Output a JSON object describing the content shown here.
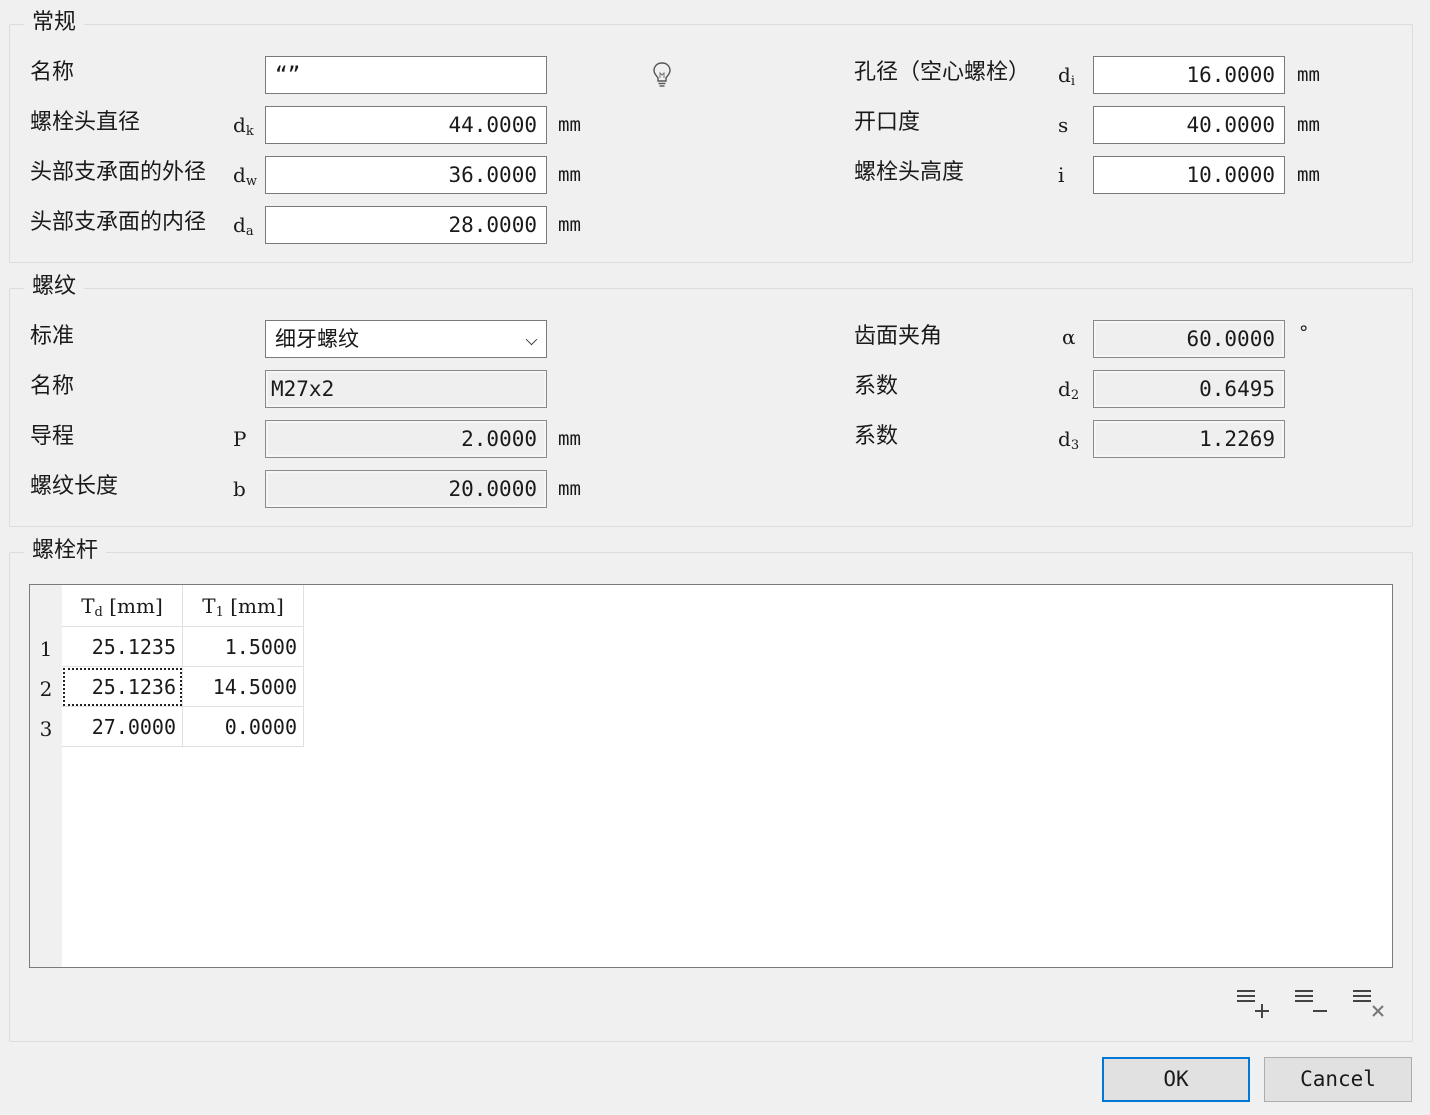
{
  "general": {
    "title": "常规",
    "name_label": "名称",
    "name_value": "“”",
    "head_dia_label": "螺栓头直径",
    "head_dia_sym": "d",
    "head_dia_sub": "k",
    "head_dia_value": "44.0000",
    "bear_outer_label": "头部支承面的外径",
    "bear_outer_sym": "d",
    "bear_outer_sub": "w",
    "bear_outer_value": "36.0000",
    "bear_inner_label": "头部支承面的内径",
    "bear_inner_sym": "d",
    "bear_inner_sub": "a",
    "bear_inner_value": "28.0000",
    "bore_label": "孔径（空心螺栓）",
    "bore_sym": "d",
    "bore_sub": "i",
    "bore_value": "16.0000",
    "wrench_label": "开口度",
    "wrench_sym": "s",
    "wrench_value": "40.0000",
    "head_height_label": "螺栓头高度",
    "head_height_sym": "i",
    "head_height_value": "10.0000",
    "unit": "mm"
  },
  "thread": {
    "title": "螺纹",
    "standard_label": "标准",
    "standard_value": "细牙螺纹",
    "name_label": "名称",
    "name_value": "M27x2",
    "pitch_label": "导程",
    "pitch_sym": "P",
    "pitch_value": "2.0000",
    "length_label": "螺纹长度",
    "length_sym": "b",
    "length_value": "20.0000",
    "flank_label": "齿面夹角",
    "flank_sym": "α",
    "flank_value": "60.0000",
    "flank_unit": "°",
    "coef1_label": "系数",
    "coef1_sym": "d",
    "coef1_sub": "2",
    "coef1_value": "0.6495",
    "coef2_label": "系数",
    "coef2_sym": "d",
    "coef2_sub": "3",
    "coef2_value": "1.2269",
    "unit": "mm"
  },
  "shank": {
    "title": "螺栓杆",
    "col1_sym": "T",
    "col1_sub": "d",
    "col1_unit": " [mm]",
    "col2_sym": "T",
    "col2_sub": "1",
    "col2_unit": " [mm]",
    "rows": [
      {
        "n": "1",
        "td": "25.1235",
        "t1": "1.5000"
      },
      {
        "n": "2",
        "td": "25.1236",
        "t1": "14.5000"
      },
      {
        "n": "3",
        "td": "27.0000",
        "t1": "0.0000"
      }
    ]
  },
  "buttons": {
    "ok": "OK",
    "cancel": "Cancel"
  }
}
